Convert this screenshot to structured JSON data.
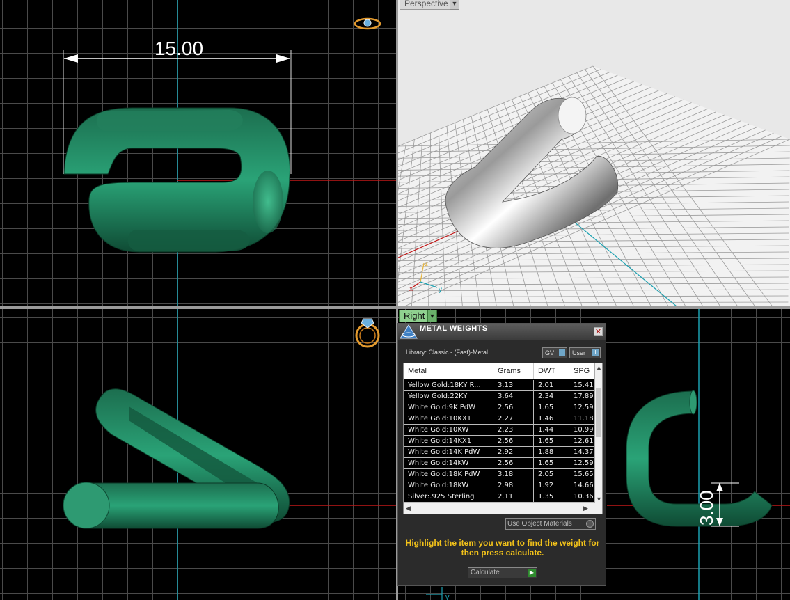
{
  "viewports": {
    "perspective_label": "Perspective",
    "right_label": "Right",
    "top_dimension": "15.00",
    "right_dimension": "3.00",
    "axis_x": "x",
    "axis_y": "y",
    "axis_z": "z"
  },
  "metal_weights": {
    "title": "METAL WEIGHTS",
    "close_symbol": "✕",
    "library_label": "Library: Classic - (Fast)-Metal",
    "gv_label": "GV",
    "user_label": "User",
    "toggle_symbol": "I",
    "columns": [
      "Metal",
      "Grams",
      "DWT",
      "SPG"
    ],
    "rows": [
      [
        "Yellow Gold:18KY R...",
        "3.13",
        "2.01",
        "15.41"
      ],
      [
        "Yellow Gold:22KY",
        "3.64",
        "2.34",
        "17.89"
      ],
      [
        "White Gold:9K PdW",
        "2.56",
        "1.65",
        "12.59"
      ],
      [
        "White Gold:10KX1",
        "2.27",
        "1.46",
        "11.18"
      ],
      [
        "White Gold:10KW",
        "2.23",
        "1.44",
        "10.99"
      ],
      [
        "White Gold:14KX1",
        "2.56",
        "1.65",
        "12.61"
      ],
      [
        "White Gold:14K PdW",
        "2.92",
        "1.88",
        "14.37"
      ],
      [
        "White Gold:14KW",
        "2.56",
        "1.65",
        "12.59"
      ],
      [
        "White Gold:18K PdW",
        "3.18",
        "2.05",
        "15.65"
      ],
      [
        "White Gold:18KW",
        "2.98",
        "1.92",
        "14.66"
      ],
      [
        "Silver:.925 Sterling",
        "2.11",
        "1.35",
        "10.36"
      ]
    ],
    "use_object_materials": "Use Object Materials",
    "hint": "Highlight the item you want to find the weight for then press calculate.",
    "calculate_label": "Calculate",
    "colors": {
      "hint": "#f2c21a",
      "link_green": "#1f7a53",
      "axis_red": "#c01818",
      "axis_cyan": "#1aa0b0"
    }
  }
}
